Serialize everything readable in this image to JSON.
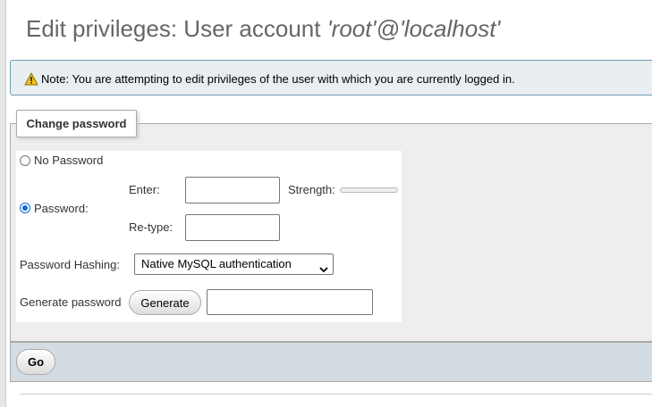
{
  "page": {
    "title_prefix": "Edit privileges: User account ",
    "title_account": "'root'@'localhost'"
  },
  "notice": {
    "icon": "warning-triangle-icon",
    "text": "Note: You are attempting to edit privileges of the user with which you are currently logged in."
  },
  "change_password": {
    "legend": "Change password",
    "options": {
      "no_password": {
        "label": "No Password",
        "selected": false
      },
      "password": {
        "label": "Password:",
        "selected": true
      }
    },
    "enter_label": "Enter:",
    "enter_value": "",
    "retype_label": "Re-type:",
    "retype_value": "",
    "strength_label": "Strength:",
    "strength_level": 0,
    "hashing_label": "Password Hashing:",
    "hashing_selected": "Native MySQL authentication",
    "generate_label": "Generate password",
    "generate_button": "Generate",
    "generated_value": ""
  },
  "footer": {
    "go_button": "Go"
  },
  "colors": {
    "accent_blue": "#0b6bd6",
    "notice_bg": "#e8eef1",
    "notice_border": "#6f9fb1",
    "footer_bg": "#d3dce3",
    "warning_yellow": "#f5c518"
  }
}
